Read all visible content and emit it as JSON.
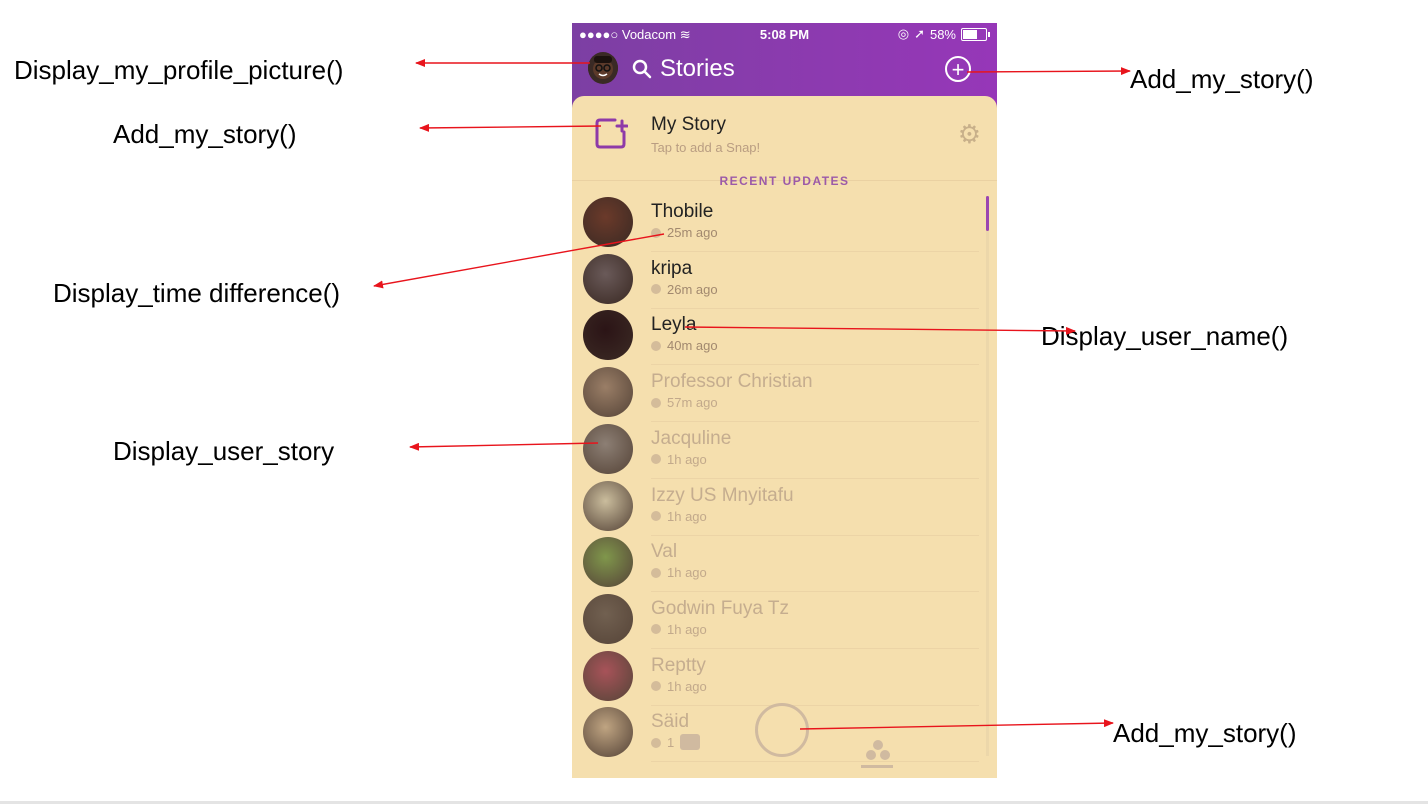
{
  "annotations": [
    {
      "id": "display-my-profile-picture",
      "text": "Display_my_profile_picture()"
    },
    {
      "id": "add-my-story-left",
      "text": "Add_my_story()"
    },
    {
      "id": "display-time-difference",
      "text": "Display_time difference()"
    },
    {
      "id": "display-user-story",
      "text": "Display_user_story"
    },
    {
      "id": "add-my-story-top-right",
      "text": "Add_my_story()"
    },
    {
      "id": "display-user-name",
      "text": "Display_user_name()"
    },
    {
      "id": "add-my-story-bottom-right",
      "text": "Add_my_story()"
    }
  ],
  "status_bar": {
    "carrier": "●●●●○ Vodacom",
    "time": "5:08 PM",
    "battery": "58%"
  },
  "header": {
    "title": "Stories",
    "add_button_label": "+"
  },
  "my_story": {
    "title": "My Story",
    "subtitle": "Tap to add a Snap!"
  },
  "section": {
    "title": "RECENT UPDATES"
  },
  "stories": [
    {
      "name": "Thobile",
      "time": "25m ago",
      "viewed": false,
      "color": "#6b3a2a"
    },
    {
      "name": "kripa",
      "time": "26m ago",
      "viewed": false,
      "color": "#6a5a59"
    },
    {
      "name": "Leyla",
      "time": "40m ago",
      "viewed": false,
      "color": "#2b1416"
    },
    {
      "name": "Professor Christian",
      "time": "57m ago",
      "viewed": true,
      "color": "#8a6d5a"
    },
    {
      "name": "Jacquline",
      "time": "1h ago",
      "viewed": true,
      "color": "#7a6e6a"
    },
    {
      "name": "Izzy US Mnyitafu",
      "time": "1h ago",
      "viewed": true,
      "color": "#c3b79a"
    },
    {
      "name": "Val",
      "time": "1h ago",
      "viewed": true,
      "color": "#6b8a3a"
    },
    {
      "name": "Godwin Fuya Tz",
      "time": "1h ago",
      "viewed": true,
      "color": "#5a4a40"
    },
    {
      "name": "Reptty",
      "time": "1h ago",
      "viewed": true,
      "color": "#9a3a4a"
    },
    {
      "name": "Säid",
      "time": "1",
      "viewed": true,
      "color": "#b69a7a"
    }
  ]
}
